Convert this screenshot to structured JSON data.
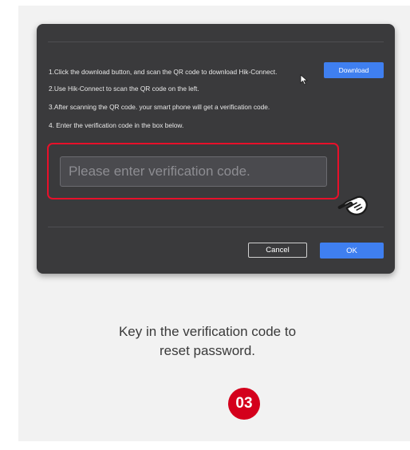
{
  "dialog": {
    "instructions": [
      "1.Click the download button, and scan the QR code to download Hik-Connect.",
      "2.Use Hik-Connect to scan the QR code on the left.",
      "3.After scanning the QR code. your smart phone will get a verification code.",
      "4. Enter the verification code in the box below."
    ],
    "download_label": "Download",
    "verification_placeholder": "Please enter verification code.",
    "cancel_label": "Cancel",
    "ok_label": "OK"
  },
  "caption": "Key in the verification code to reset password.",
  "step_number": "03",
  "icons": {
    "cursor": "arrow-cursor-icon",
    "hand": "pointing-hand-icon"
  },
  "colors": {
    "dialog_bg": "#3a3a3c",
    "accent_blue": "#3f7ff0",
    "highlight_red": "#e8102a",
    "badge_red": "#d4001c"
  }
}
